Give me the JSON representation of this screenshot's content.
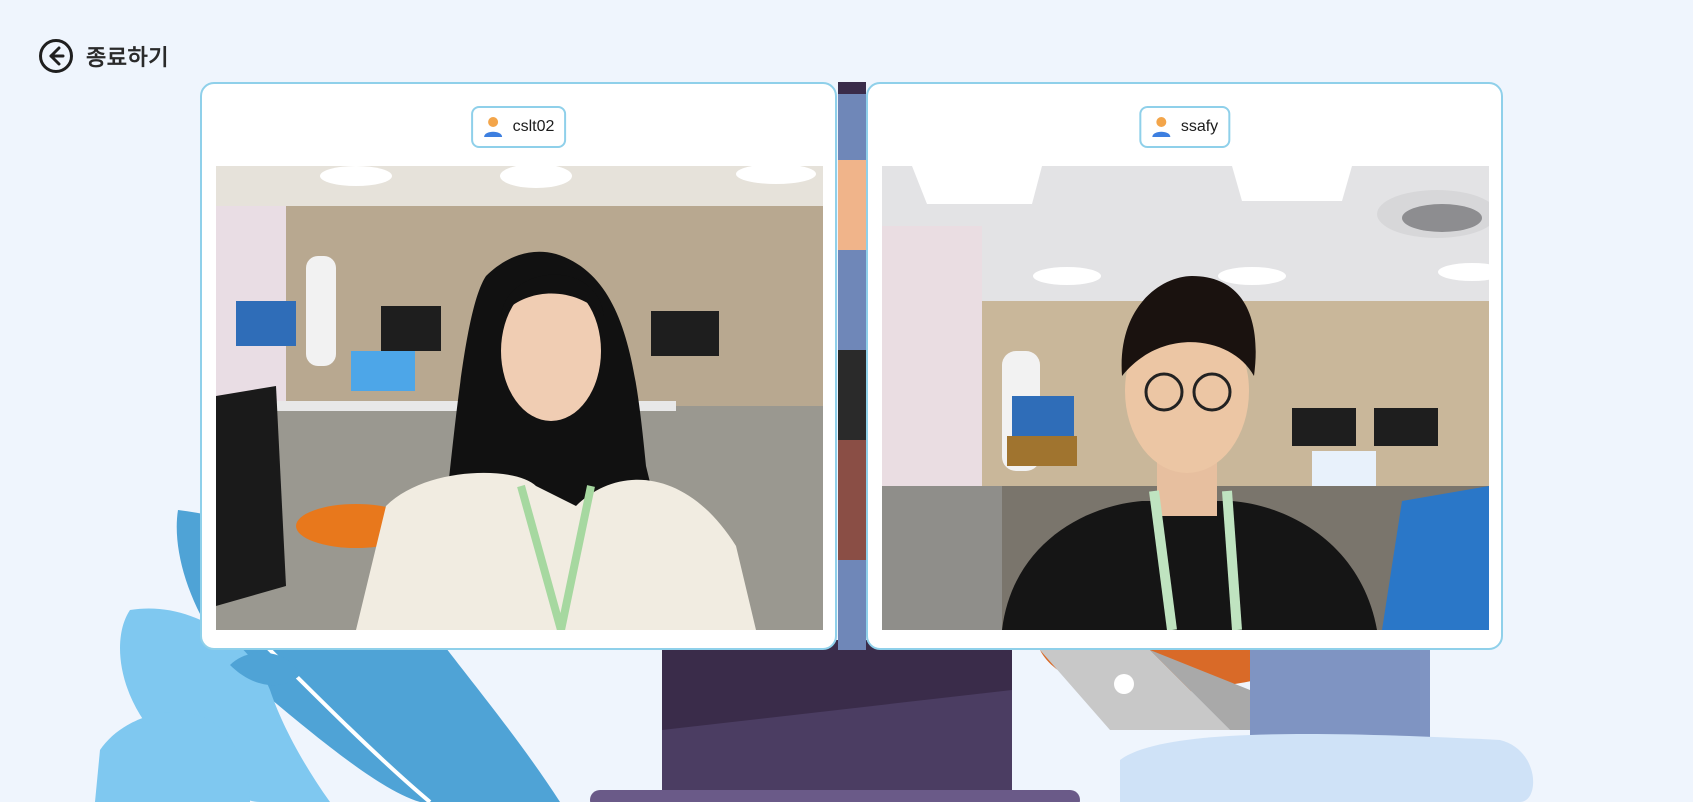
{
  "header": {
    "exit_label": "종료하기",
    "exit_icon": "arrow-left-circle-icon"
  },
  "participants": [
    {
      "username": "cslt02",
      "icon": "user-icon"
    },
    {
      "username": "ssafy",
      "icon": "user-icon"
    }
  ],
  "colors": {
    "page_background": "#eff5fd",
    "card_border": "#8fd0ea",
    "illustration_blue": "#4fa3d6",
    "illustration_light_blue": "#7fc8f0",
    "illustration_purple": "#3d2e4f"
  }
}
